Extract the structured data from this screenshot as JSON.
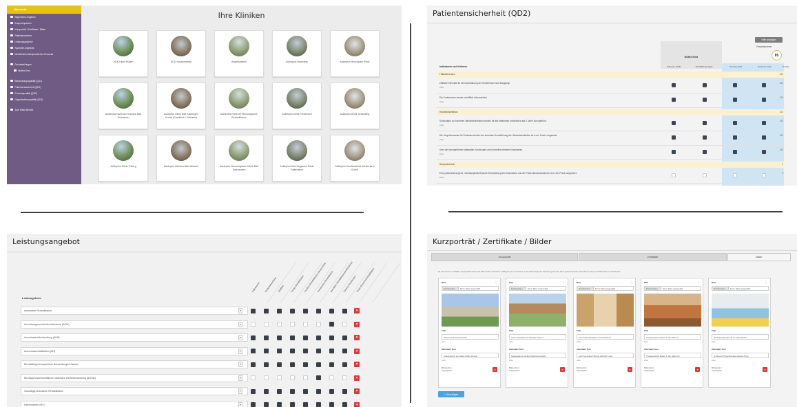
{
  "clinics_panel": {
    "sidebar_header": "Übersicht",
    "sidebar_items": [
      "Allgemeine Angaben",
      "Ansprechpartner",
      "Kurzporträt / Zertifikate / Bilder",
      "Patientenzimmer",
      "Leistungsangebot",
      "Spezielle Angebote",
      "Medizinisch-therapeutisches Personal",
      "Fachabteilungen",
      "Mutter-Kind",
      "Behandlungsqualität (QD1)",
      "Patientensicherheit (QD2)",
      "Prozessqualität (QD3)",
      "Organisationsqualität (QD4)",
      "Zum Klinik-Bericht"
    ],
    "title": "Ihre Kliniken",
    "clinics": [
      "AOK-Klinik Rügen",
      "AOK Nordseeklinik",
      "Angelikaklinik",
      "Asklepios Harzklinik",
      "Asklepios Hirschpark Klinik",
      "Asklepios Klinik Am Kurpark Bad Schwartau",
      "Asklepios Klinik Bad Salzungen GmbH (Parkklinik / Katharina",
      "Asklepios Klinik für Neurologische Rehabilitation",
      "Asklepios Klinik Fürstenhof",
      "Asklepios Klinik Schaufling",
      "Asklepios Klinik Triberg",
      "Asklepios Klinikum Bad Abbach",
      "Asklepios Neurologische Klinik Bad Salzhausen",
      "Asklepios Neurologische Klinik Falkenstein",
      "Asklepios Nordseeklinik Westerland GmbH"
    ]
  },
  "safety_panel": {
    "title": "Patientensicherheit (QD2)",
    "help_button": "Hilfe anzeigen",
    "total_label": "Gesamtsumme",
    "total_score": "85",
    "group_label": "Mutter-Kind",
    "criteria_header": "Indikatoren und Kriterien",
    "columns": [
      "Kriterium erfüllt",
      "Schriftlich geregelt",
      "Internes Audit",
      "Externes Audit",
      "Punkte"
    ],
    "info_label": "Infos",
    "rows": [
      {
        "kind": "section",
        "text": "Fallkonferenzen",
        "points": "100"
      },
      {
        "kind": "item",
        "text": "Zeitliche Intervalle für die Durchführung der Konferenzen sind festgelegt.",
        "points": "100",
        "checks": [
          true,
          true,
          true,
          true
        ]
      },
      {
        "kind": "item",
        "text": "Die Konferenzen werden schriftlich dokumentiert.",
        "points": "100",
        "checks": [
          true,
          true,
          true,
          true
        ]
      },
      {
        "kind": "section",
        "text": "Händedesinfektion",
        "points": "100"
      },
      {
        "kind": "item",
        "text": "Schulungen zur korrekten Händedesinfektion werden für alle Mitarbeiter mindestens alle 2 Jahre durchgeführt.",
        "points": "100",
        "checks": [
          true,
          true,
          true,
          true
        ]
      },
      {
        "kind": "item",
        "text": "Die Vorgehensweise für Routinekontrollen der korrekten Durchführung der Händedesinfektion ist in der Praxis umgesetzt.",
        "points": "100",
        "checks": [
          true,
          true,
          true,
          true
        ]
      },
      {
        "kind": "item",
        "text": "Über die durchgeführten Mitarbeiter-Schulungen und Kontrollen bestehen Nachweise.",
        "points": "100",
        "checks": [
          true,
          true,
          true,
          true
        ]
      },
      {
        "kind": "section",
        "text": "Sturzprävention",
        "points": "0"
      },
      {
        "kind": "item",
        "text": "Eine patientenbezogene, interdisziplinärrelevante Einschätzung des Sturzrisikos und der Präventionsmaßnahmen ist in der Praxis umgesetzt.",
        "points": "0",
        "checks": [
          false,
          false,
          false,
          false
        ]
      }
    ]
  },
  "services_panel": {
    "title": "Leistungsangebot",
    "column_header": "Leistungsform",
    "diagonal_headers": [
      "Indikationen",
      "Kinderbehandlung",
      "Mobilität",
      "Kinder-Rehabilitation",
      "Familien-Rehabilitation (Mutter-Kind)",
      "Geriatrische Rehabilitation",
      "Berufliche Rehabilitationsmaßnahmen",
      "Externe Reisekosten",
      "Frühe Reha/Frührehabilitation"
    ],
    "rows": [
      {
        "label": "Ambulante Rehabilitation",
        "checks": [
          true,
          true,
          true,
          true,
          true,
          true,
          true,
          true
        ]
      },
      {
        "label": "Anschlussgesundheitsmaßnahme (AGM)",
        "checks": [
          false,
          false,
          false,
          false,
          false,
          false,
          true,
          false
        ]
      },
      {
        "label": "Anschlussheilbehandlung (AHB)",
        "checks": [
          true,
          true,
          true,
          true,
          true,
          true,
          true,
          true
        ]
      },
      {
        "label": "Anschlussrehabilitation (AR)",
        "checks": [
          true,
          true,
          true,
          true,
          true,
          true,
          true,
          true
        ]
      },
      {
        "label": "Berufsfähigkeit assoziierte Behandlungsverfahren",
        "checks": [
          true,
          true,
          true,
          true,
          true,
          true,
          true,
          true
        ]
      },
      {
        "label": "Berufsgenossenschaftliche stationäre Weiterbehandlung (BGSW)",
        "checks": [
          false,
          false,
          false,
          false,
          false,
          true,
          false,
          false
        ]
      },
      {
        "label": "Ganztägig ambulante Rehabilitation",
        "checks": [
          true,
          true,
          true,
          true,
          true,
          true,
          true,
          true
        ]
      },
      {
        "label": "Heilverfahren (HV)",
        "checks": [
          true,
          true,
          true,
          true,
          true,
          true,
          true,
          true
        ]
      }
    ]
  },
  "portrait_panel": {
    "title": "Kurzporträt / Zertifikate / Bilder",
    "tabs": [
      "Kurzporträt",
      "Zertifikate",
      "Bilder"
    ],
    "instructions": "Es können bis zu 10 Bilder ausgewählt werden. Die Bilder sollten höchstens 2 MB groß sein und können in die Reihenfolge der Darstellung auf Ihrer Seite gebracht werden. Eine Beschreibung mit Bildinhalten ist erforderlich.",
    "image_label": "Bild",
    "browse_label": "Durchsuchen...",
    "no_file_label": "Keine Datei ausgewählt",
    "title_label": "Titel",
    "alt_label": "Alternativ Text",
    "info_label": "Infos",
    "meta_lines": [
      "Bilddetektiert",
      "Originalgröße"
    ],
    "add_button": "+ Hinzufügen",
    "images": [
      {
        "title": "Helios Klinik Hohenstücken",
        "alt": "Außenansicht der Helios Klinik Hohenst",
        "scene": "building"
      },
      {
        "title": "Auch außerhalb der Therapie bieten w",
        "alt": "Speisesaal der Helios Klinik Hohenstück",
        "scene": "courtyard"
      },
      {
        "title": "Durch Sporttherapie in verschiedenen",
        "alt": "Durch gezieltes Training soll Kraft, Ausc",
        "scene": "gym"
      },
      {
        "title": "Therapeutische Reiten in der Helios K",
        "alt": "Therapeutische Reiten in der Helios Kli",
        "scene": "hall"
      },
      {
        "title": "Die Physiotherapie ist ein wesentlicher",
        "alt": "Im Bereich Physiotherapie arbeiten Phys",
        "scene": "pool"
      }
    ]
  }
}
